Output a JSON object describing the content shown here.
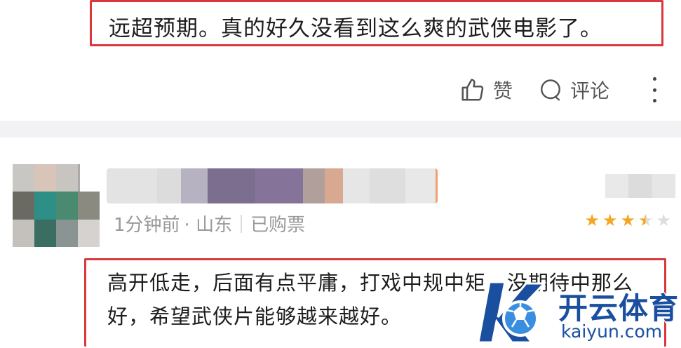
{
  "first_comment": {
    "text": "远超预期。真的好久没看到这么爽的武侠电影了。",
    "like_label": "赞",
    "comment_label": "评论"
  },
  "second_comment": {
    "time": "1分钟前",
    "location": "· 山东",
    "purchase_status": "已购票",
    "rating": 3.5,
    "rating_max": 5,
    "text": "高开低走，后面有点平庸，打戏中规中矩，没期待中那么好，希望武侠片能够越来越好。"
  },
  "watermark": {
    "title": "开云体育",
    "subtitle": "kaiyun.com"
  },
  "colors": {
    "highlight": "#d9383d",
    "star": "#f5a623",
    "star_empty": "#dddddd",
    "watermark": "#1a4fa0"
  }
}
